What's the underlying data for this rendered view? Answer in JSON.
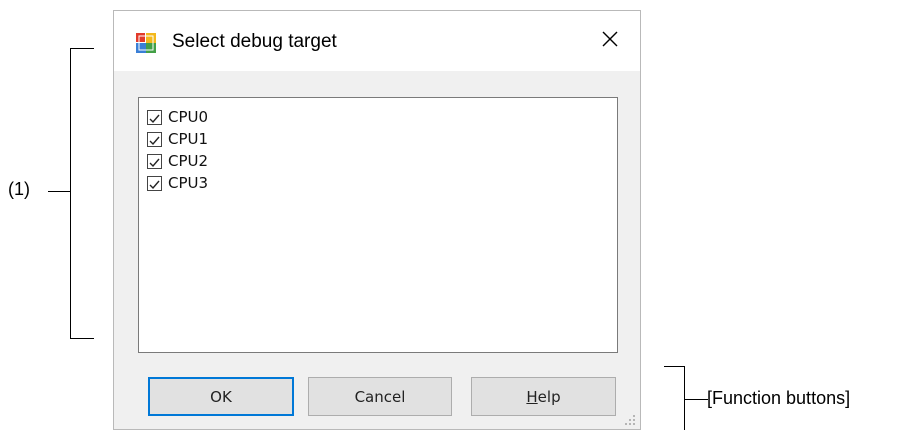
{
  "dialog": {
    "title": "Select debug target",
    "items": [
      {
        "label": "CPU0",
        "checked": true
      },
      {
        "label": "CPU1",
        "checked": true
      },
      {
        "label": "CPU2",
        "checked": true
      },
      {
        "label": "CPU3",
        "checked": true
      }
    ],
    "buttons": {
      "ok": "OK",
      "cancel": "Cancel",
      "help_prefix": "",
      "help_mnemonic": "H",
      "help_rest": "elp"
    }
  },
  "annotations": {
    "list_label": "(1)",
    "buttons_label": "[Function buttons]"
  },
  "colors": {
    "dialog_bg": "#f0f0f0",
    "default_button_border": "#0078d7"
  }
}
